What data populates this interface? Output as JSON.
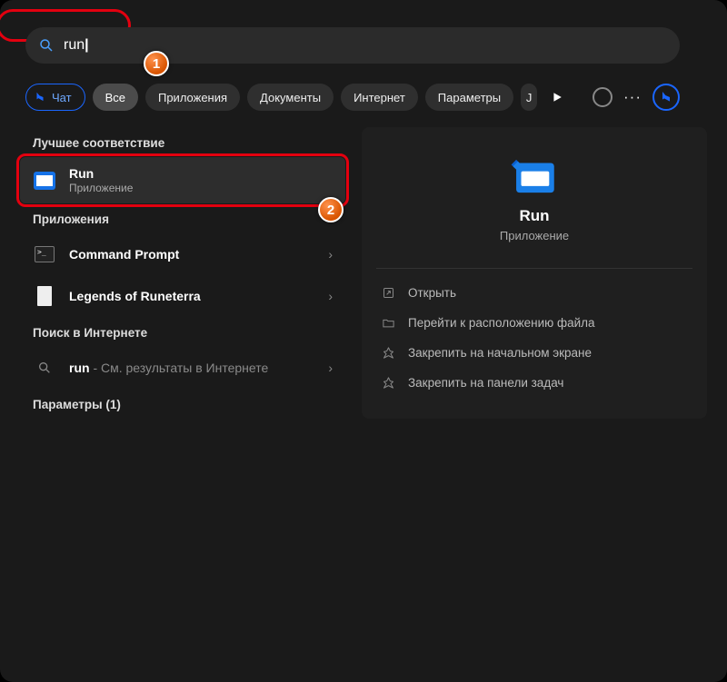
{
  "search": {
    "query": "run"
  },
  "filters": {
    "chat": "Чат",
    "all": "Все",
    "apps": "Приложения",
    "docs": "Документы",
    "internet": "Интернет",
    "settings": "Параметры"
  },
  "sections": {
    "best_match": "Лучшее соответствие",
    "apps": "Приложения",
    "web": "Поиск в Интернете",
    "settings": "Параметры (1)"
  },
  "results": {
    "run": {
      "title": "Run",
      "subtitle": "Приложение"
    },
    "cmd": {
      "title_prefix": "Command Prompt"
    },
    "lor": {
      "title_prefix": "Legends of ",
      "title_bold": "Run",
      "title_suffix": "eterra"
    },
    "web": {
      "prefix": "run",
      "suffix": " - См. результаты в Интернете"
    }
  },
  "details": {
    "title": "Run",
    "subtitle": "Приложение",
    "actions": {
      "open": "Открыть",
      "file_location": "Перейти к расположению файла",
      "pin_start": "Закрепить на начальном экране",
      "pin_taskbar": "Закрепить на панели задач"
    }
  },
  "callouts": {
    "one": "1",
    "two": "2"
  }
}
